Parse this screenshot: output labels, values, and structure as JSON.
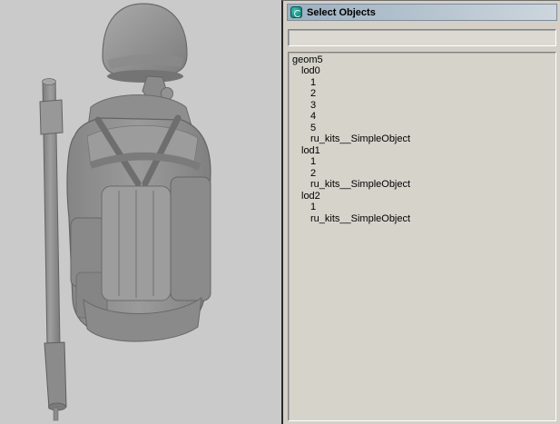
{
  "viewport": {
    "background": "#cacaca",
    "model_name": "soldier-kit-3d-model",
    "model_base_color": "#929292",
    "model_outline_color": "#646464"
  },
  "dialog": {
    "title": "Select Objects",
    "icon": "select-objects-icon",
    "titlebar_color_left": "#9db0c1",
    "titlebar_color_right": "#cdd6dd",
    "background": "#d4d0c8",
    "search_value": "",
    "list": [
      {
        "label": "geom5",
        "indent": 0
      },
      {
        "label": "lod0",
        "indent": 1
      },
      {
        "label": "1",
        "indent": 2
      },
      {
        "label": "2",
        "indent": 2
      },
      {
        "label": "3",
        "indent": 2
      },
      {
        "label": "4",
        "indent": 2
      },
      {
        "label": "5",
        "indent": 2
      },
      {
        "label": "ru_kits__SimpleObject",
        "indent": 2
      },
      {
        "label": "lod1",
        "indent": 1
      },
      {
        "label": "1",
        "indent": 2
      },
      {
        "label": "2",
        "indent": 2
      },
      {
        "label": "ru_kits__SimpleObject",
        "indent": 2
      },
      {
        "label": "lod2",
        "indent": 1
      },
      {
        "label": "1",
        "indent": 2
      },
      {
        "label": "ru_kits__SimpleObject",
        "indent": 2
      }
    ]
  }
}
